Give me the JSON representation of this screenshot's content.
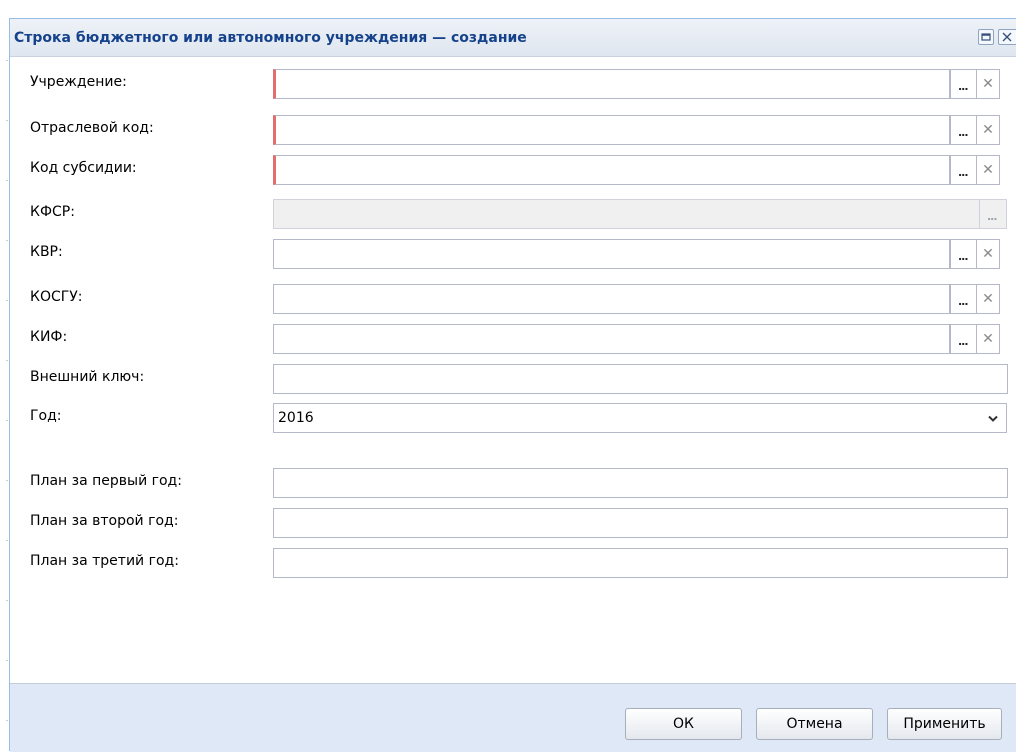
{
  "window": {
    "title": "Строка бюджетного или автономного учреждения — создание"
  },
  "fields": {
    "institution": {
      "label": "Учреждение:",
      "value": ""
    },
    "industry_code": {
      "label": "Отраслевой код:",
      "value": ""
    },
    "subsidy_code": {
      "label": "Код субсидии:",
      "value": ""
    },
    "kfsr": {
      "label": "КФСР:",
      "value": ""
    },
    "kvr": {
      "label": "КВР:",
      "value": ""
    },
    "kosgu": {
      "label": "КОСГУ:",
      "value": ""
    },
    "kif": {
      "label": "КИФ:",
      "value": ""
    },
    "external_key": {
      "label": "Внешний ключ:",
      "value": ""
    },
    "year": {
      "label": "Год:",
      "value": "2016"
    },
    "plan_year1": {
      "label": "План за первый год:",
      "value": ""
    },
    "plan_year2": {
      "label": "План за второй год:",
      "value": ""
    },
    "plan_year3": {
      "label": "План за третий год:",
      "value": ""
    }
  },
  "icons": {
    "lookup": "ellipsis-icon",
    "clear": "clear-x-icon",
    "dropdown": "chevron-down-icon",
    "maximize": "maximize-icon",
    "close": "close-icon"
  },
  "buttons": {
    "ok": "ОК",
    "cancel": "Отмена",
    "apply": "Применить"
  },
  "colors": {
    "title_text": "#15428b",
    "window_bg": "#dfe8f6",
    "required_marker": "#e36d6d",
    "field_border": "#b5b8c8"
  }
}
